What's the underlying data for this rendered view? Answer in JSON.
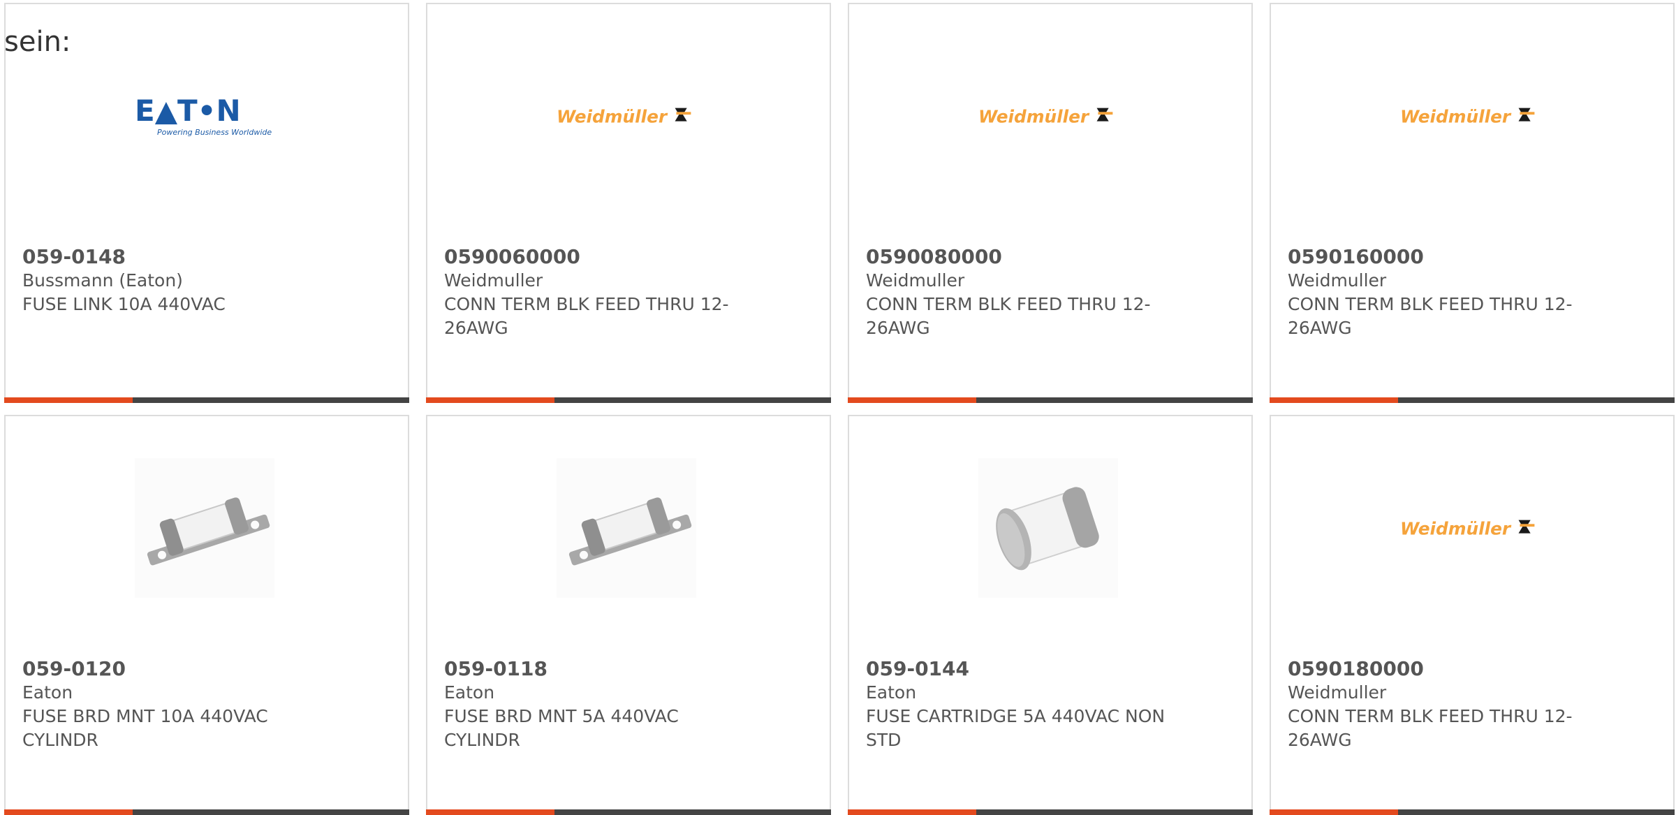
{
  "intro_text": "sein:",
  "colors": {
    "accent": "#e34a1e",
    "bar": "#444444",
    "text": "#555555",
    "eaton_blue": "#1b5aa6",
    "weidmuller_orange": "#f5a33b"
  },
  "products": [
    {
      "part_number": "059-0148",
      "manufacturer": "Bussmann (Eaton)",
      "description": "FUSE LINK 10A 440VAC",
      "image": "eaton-logo",
      "logo_main": "E▲T•N",
      "logo_sub": "Powering Business Worldwide"
    },
    {
      "part_number": "0590060000",
      "manufacturer": "Weidmuller",
      "description": "CONN TERM BLK FEED THRU 12-26AWG",
      "image": "weidmuller-logo",
      "logo_main": "Weidmüller"
    },
    {
      "part_number": "0590080000",
      "manufacturer": "Weidmuller",
      "description": "CONN TERM BLK FEED THRU 12-26AWG",
      "image": "weidmuller-logo",
      "logo_main": "Weidmüller"
    },
    {
      "part_number": "0590160000",
      "manufacturer": "Weidmuller",
      "description": "CONN TERM BLK FEED THRU 12-26AWG",
      "image": "weidmuller-logo",
      "logo_main": "Weidmüller"
    },
    {
      "part_number": "059-0120",
      "manufacturer": "Eaton",
      "description": "FUSE BRD MNT 10A 440VAC CYLINDR",
      "image": "bolted-fuse-icon"
    },
    {
      "part_number": "059-0118",
      "manufacturer": "Eaton",
      "description": "FUSE BRD MNT 5A 440VAC CYLINDR",
      "image": "bolted-fuse-icon"
    },
    {
      "part_number": "059-0144",
      "manufacturer": "Eaton",
      "description": "FUSE CARTRIDGE 5A 440VAC NON STD",
      "image": "cartridge-fuse-icon"
    },
    {
      "part_number": "0590180000",
      "manufacturer": "Weidmuller",
      "description": "CONN TERM BLK FEED THRU 12-26AWG",
      "image": "weidmuller-logo",
      "logo_main": "Weidmüller"
    }
  ]
}
